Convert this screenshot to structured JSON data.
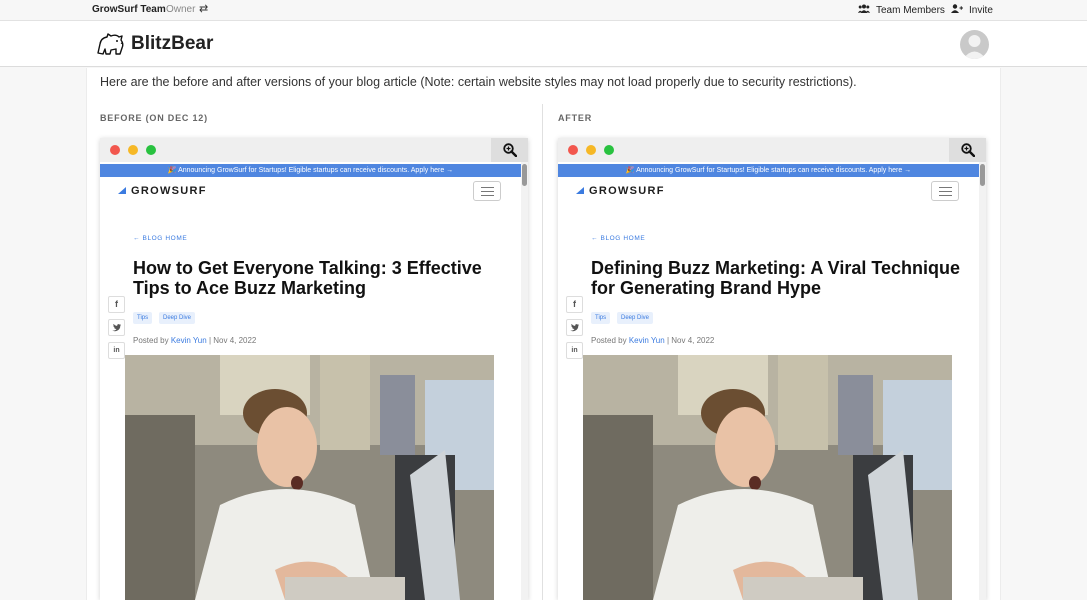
{
  "topbar": {
    "team": "GrowSurf Team",
    "role": "Owner",
    "team_members": "Team Members",
    "invite": "Invite"
  },
  "header": {
    "brand": "BlitzBear"
  },
  "intro": "Here are the before and after versions of your blog article (Note: certain website styles may not load properly due to security restrictions).",
  "before": {
    "label": "BEFORE (ON DEC 12)",
    "announcement": "🎉 Announcing GrowSurf for Startups! Eligible startups can receive discounts. Apply here →",
    "logo": "GROWSURF",
    "back_link": "← BLOG HOME",
    "title": "How to Get Everyone Talking: 3 Effective Tips to Ace Buzz Marketing",
    "tags": [
      "Tips",
      "Deep Dive"
    ],
    "posted_by": "Posted by",
    "author": "Kevin Yun",
    "date": "| Nov 4, 2022"
  },
  "after": {
    "label": "AFTER",
    "announcement": "🎉 Announcing GrowSurf for Startups! Eligible startups can receive discounts. Apply here →",
    "logo": "GROWSURF",
    "back_link": "← BLOG HOME",
    "title": "Defining Buzz Marketing: A Viral Technique for Generating Brand Hype",
    "tags": [
      "Tips",
      "Deep Dive"
    ],
    "posted_by": "Posted by",
    "author": "Kevin Yun",
    "date": "| Nov 4, 2022"
  },
  "share_icons": [
    "facebook-icon",
    "twitter-icon",
    "linkedin-icon"
  ],
  "colors": {
    "accent_blue": "#3b7be0",
    "announcement_bar": "#4f86e0",
    "mac_red": "#f2574e",
    "mac_yellow": "#f6b826",
    "mac_green": "#29c240"
  }
}
